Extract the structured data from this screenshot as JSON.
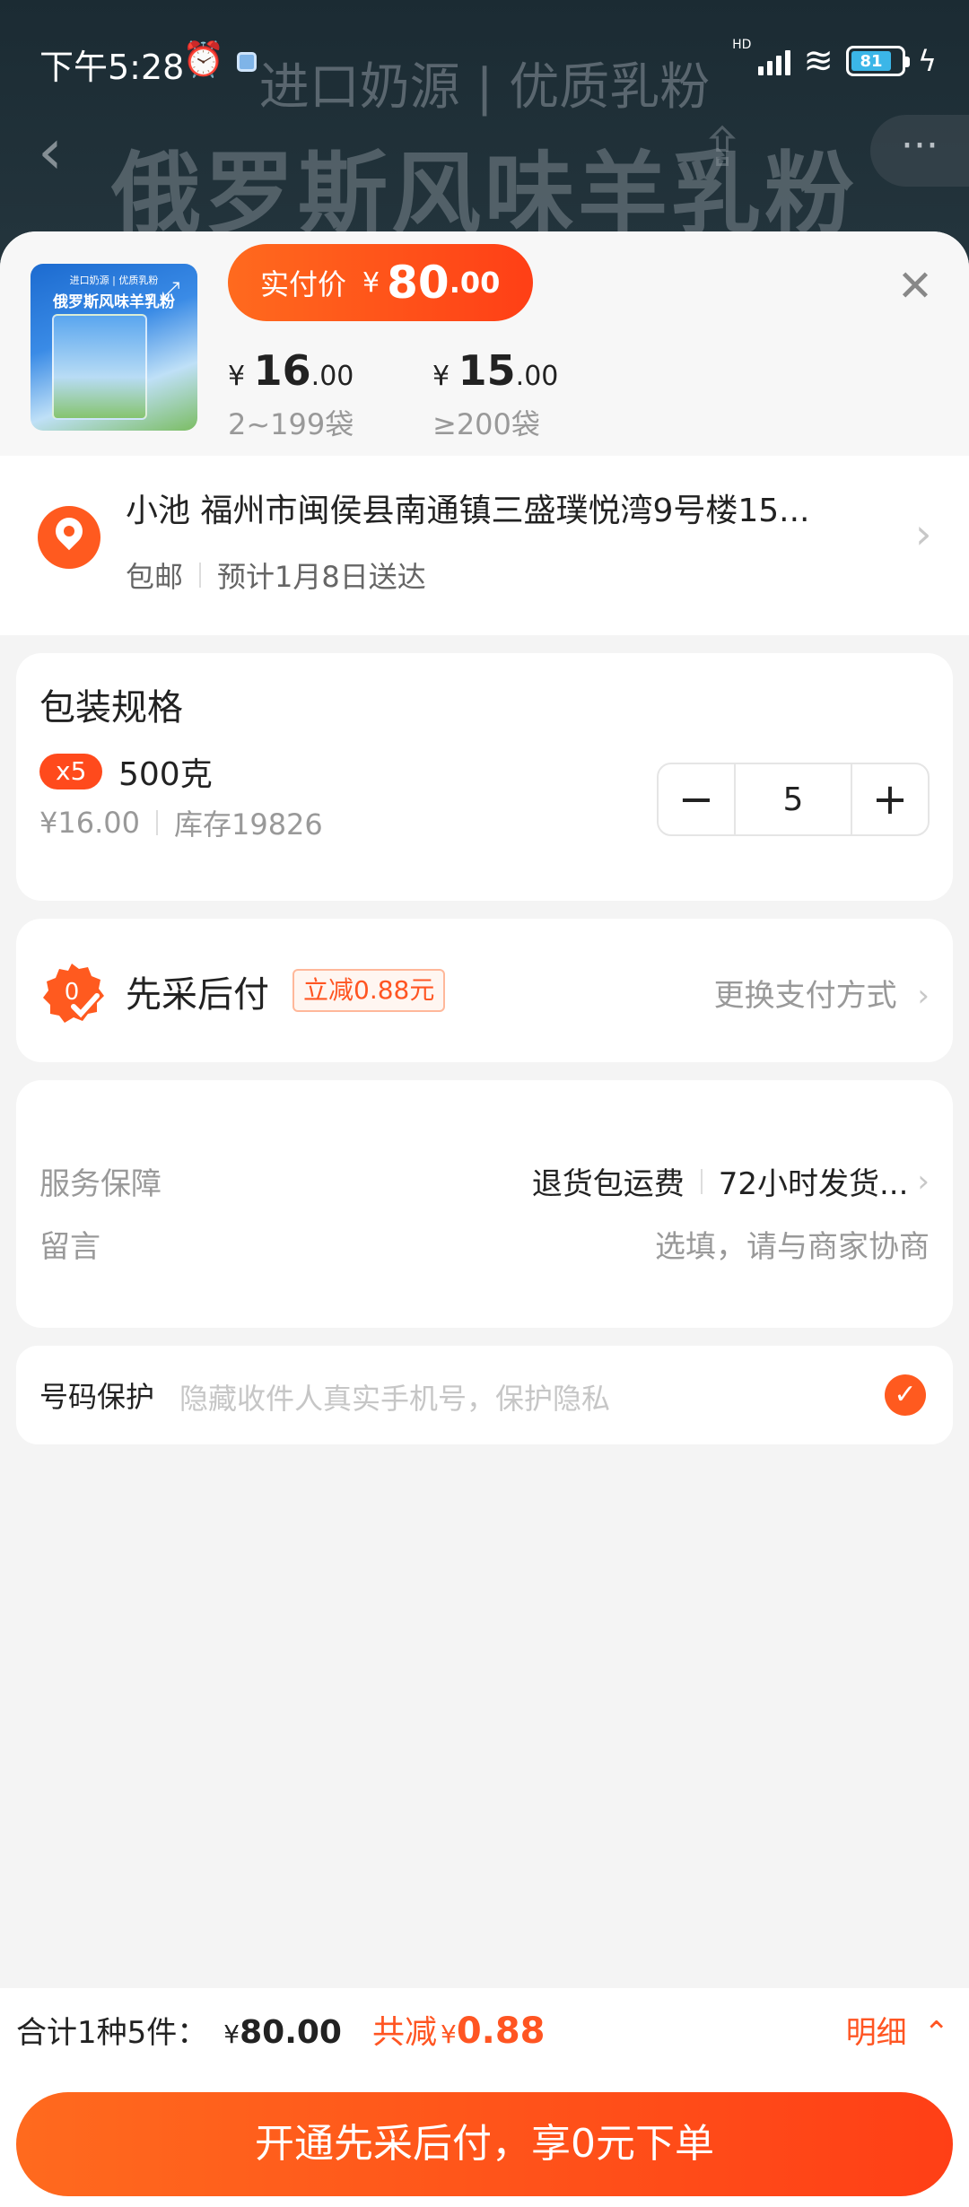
{
  "background": {
    "subtitle": "进口奶源 | 优质乳粉",
    "title": "俄罗斯风味羊乳粉"
  },
  "status_bar": {
    "time": "下午5:28",
    "network": "HD",
    "battery": "81"
  },
  "product": {
    "thumbnail_top": "进口奶源 | 优质乳粉",
    "thumbnail_title": "俄罗斯风味羊乳粉",
    "pay_label": "实付价",
    "pay_currency": "¥",
    "pay_int": "80",
    "pay_dec": ".00",
    "tiers": [
      {
        "currency": "¥",
        "int": "16",
        "dec": ".00",
        "range": "2~199袋"
      },
      {
        "currency": "¥",
        "int": "15",
        "dec": ".00",
        "range": "≥200袋"
      }
    ]
  },
  "address": {
    "line1": "小池 福州市闽侯县南通镇三盛璞悦湾9号楼15...",
    "shipping": "包邮",
    "eta": "预计1月8日送达"
  },
  "spec": {
    "title": "包装规格",
    "qty_badge": "x5",
    "name": "500克",
    "unit_price": "¥16.00",
    "stock": "库存19826",
    "quantity": "5"
  },
  "pay_later": {
    "title": "先采后付",
    "discount_tag": "立减0.88元",
    "change_label": "更换支付方式"
  },
  "service": {
    "guarantee_label": "服务保障",
    "guarantee_value_1": "退货包运费",
    "guarantee_value_2": "72小时发货...",
    "message_label": "留言",
    "message_placeholder": "选填，请与商家协商"
  },
  "phone_protect": {
    "label": "号码保护",
    "hint": "隐藏收件人真实手机号，保护隐私",
    "checked": true
  },
  "footer": {
    "total_label": "合计1种5件：",
    "total_currency": "¥",
    "total_amount": "80.00",
    "save_label": "共减",
    "save_currency": "¥",
    "save_amount": "0.88",
    "detail_label": "明细",
    "submit_label": "开通先采后付，享0元下单"
  },
  "colors": {
    "accent": "#ff4a1c",
    "accent_gradient_start": "#ff6a1e"
  }
}
